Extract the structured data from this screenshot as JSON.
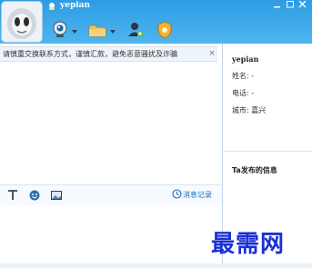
{
  "window": {
    "username": "yepian"
  },
  "toolbar": {
    "icons": [
      "webcam-icon",
      "folder-icon",
      "contact-icon",
      "shield-icon"
    ]
  },
  "chat": {
    "notice_text": "请慎重交换联系方式，谨慎汇款，避免恶意骚扰及诈骗",
    "notice_close": "×",
    "history_label": "消息记录"
  },
  "info": {
    "name": "yepian",
    "surname_line": "姓名: -",
    "phone_line": "电话: -",
    "city_line": "城市: 嘉兴",
    "ta_published": "Ta发布的信息"
  },
  "watermark": "最需网",
  "colors": {
    "titlebar": "#3aa7ea",
    "accent": "#1b6dbf",
    "watermark": "#1b2fd4"
  }
}
